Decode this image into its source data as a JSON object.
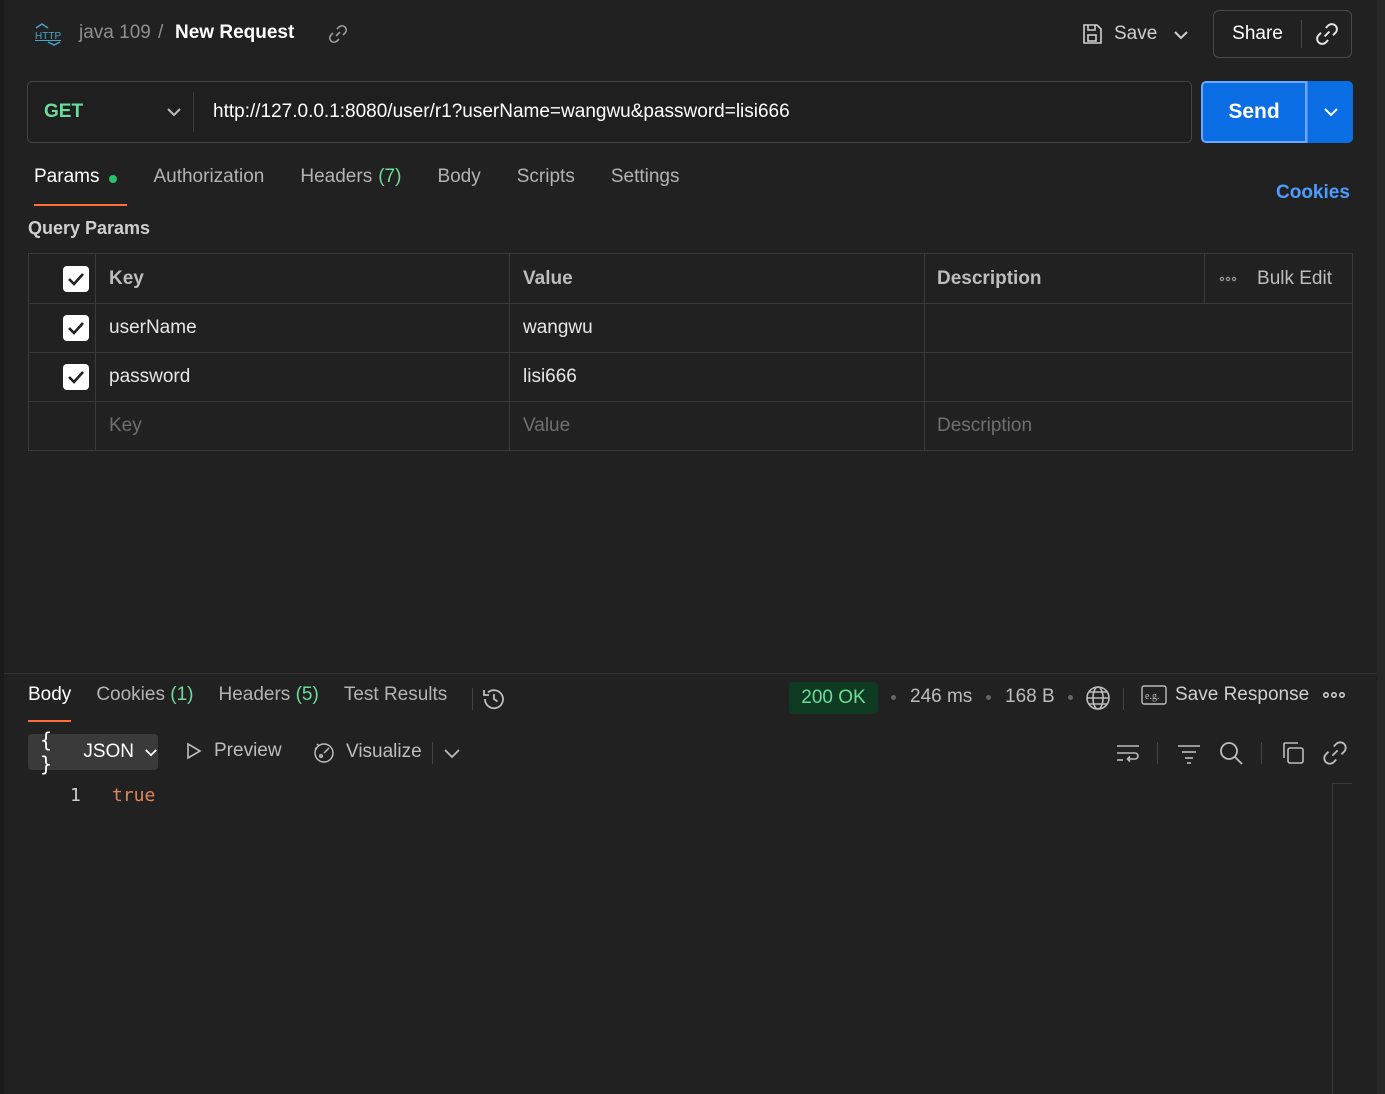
{
  "breadcrumb": {
    "collection": "java 109",
    "separator": "/",
    "title": "New Request"
  },
  "toolbar": {
    "save_label": "Save",
    "share_label": "Share"
  },
  "request": {
    "method": "GET",
    "url": "http://127.0.0.1:8080/user/r1?userName=wangwu&password=lisi666",
    "send_label": "Send"
  },
  "tabs": [
    {
      "label": "Params",
      "count": ""
    },
    {
      "label": "Authorization",
      "count": ""
    },
    {
      "label": "Headers",
      "count": "(7)"
    },
    {
      "label": "Body",
      "count": ""
    },
    {
      "label": "Scripts",
      "count": ""
    },
    {
      "label": "Settings",
      "count": ""
    }
  ],
  "cookies_link": "Cookies",
  "query_params": {
    "title": "Query Params",
    "headers": {
      "key": "Key",
      "value": "Value",
      "description": "Description",
      "bulk_edit": "Bulk Edit"
    },
    "rows": [
      {
        "key": "userName",
        "value": "wangwu",
        "description": "",
        "checked": true
      },
      {
        "key": "password",
        "value": "lisi666",
        "description": "",
        "checked": true
      }
    ],
    "placeholders": {
      "key": "Key",
      "value": "Value",
      "description": "Description"
    }
  },
  "response": {
    "tabs": [
      {
        "label": "Body",
        "count": ""
      },
      {
        "label": "Cookies",
        "count": "(1)"
      },
      {
        "label": "Headers",
        "count": "(5)"
      },
      {
        "label": "Test Results",
        "count": ""
      }
    ],
    "status": "200 OK",
    "time": "246 ms",
    "size": "168 B",
    "save_response": "Save Response",
    "format": "JSON",
    "format_braces": "{ }",
    "preview": "Preview",
    "visualize": "Visualize",
    "lines": [
      {
        "num": "1",
        "text": "true"
      }
    ]
  },
  "colors": {
    "accent": "#ff6c37",
    "send": "#0b6de3",
    "method": "#6bdd9a",
    "status_bg": "#0f3a22",
    "link": "#4d9cff"
  }
}
